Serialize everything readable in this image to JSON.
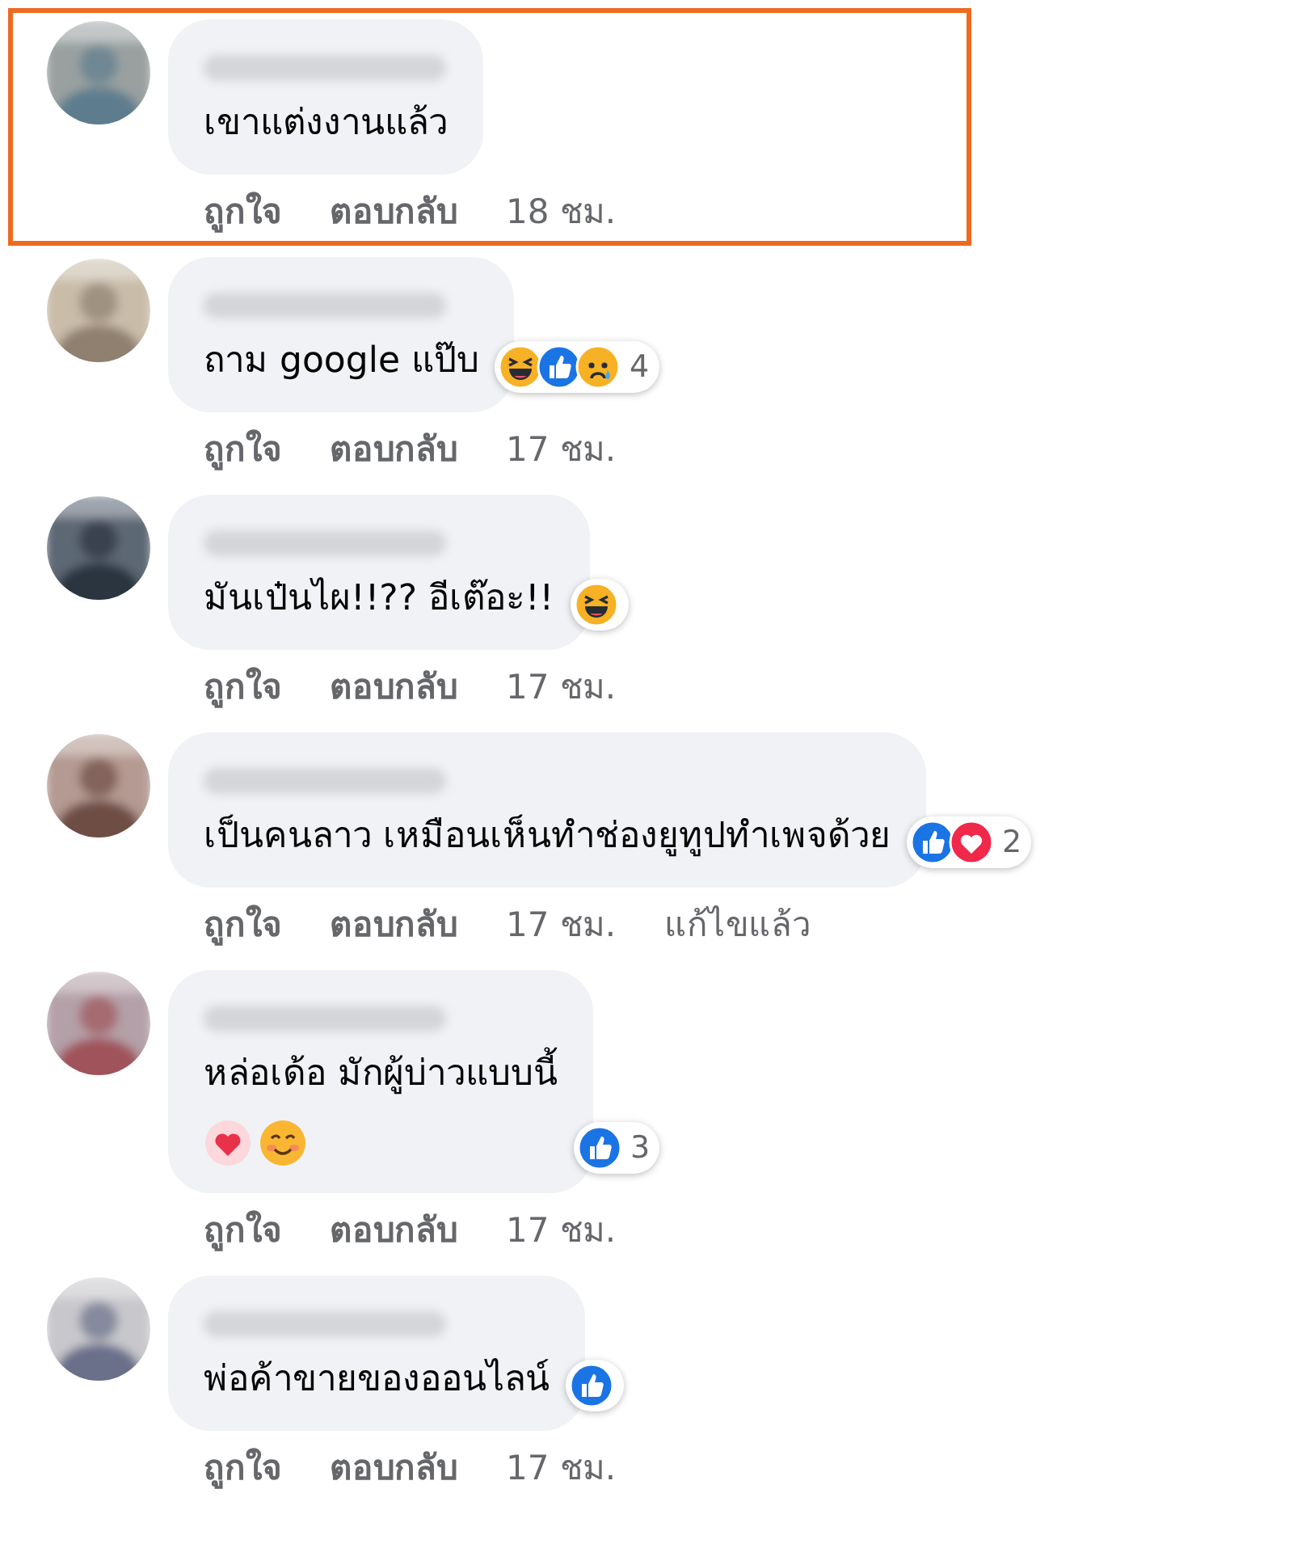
{
  "comments": [
    {
      "highlighted": true,
      "text": "เขาแต่งงานแล้ว",
      "actions": [
        {
          "kind": "link",
          "label": "ถูกใจ"
        },
        {
          "kind": "link",
          "label": "ตอบกลับ"
        },
        {
          "kind": "time",
          "label": "18 ชม."
        }
      ]
    },
    {
      "highlighted": false,
      "text": "ถาม google แป๊บ",
      "reactions": {
        "icons": [
          {
            "kind": "haha"
          },
          {
            "kind": "like"
          },
          {
            "kind": "sad"
          }
        ],
        "count": "4"
      },
      "actions": [
        {
          "kind": "link",
          "label": "ถูกใจ"
        },
        {
          "kind": "link",
          "label": "ตอบกลับ"
        },
        {
          "kind": "time",
          "label": "17 ชม."
        }
      ]
    },
    {
      "highlighted": false,
      "text": "มันเป๋นไผ!!?? อีเต๊อะ!!",
      "reactions": {
        "icons": [
          {
            "kind": "haha"
          }
        ]
      },
      "actions": [
        {
          "kind": "link",
          "label": "ถูกใจ"
        },
        {
          "kind": "link",
          "label": "ตอบกลับ"
        },
        {
          "kind": "time",
          "label": "17 ชม."
        }
      ]
    },
    {
      "highlighted": false,
      "text": "เป็นคนลาว เหมือนเห็นทำช่องยูทูปทำเพจด้วย",
      "reactions": {
        "icons": [
          {
            "kind": "like"
          },
          {
            "kind": "love"
          }
        ],
        "count": "2"
      },
      "actions": [
        {
          "kind": "link",
          "label": "ถูกใจ"
        },
        {
          "kind": "link",
          "label": "ตอบกลับ"
        },
        {
          "kind": "time",
          "label": "17 ชม."
        },
        {
          "kind": "note",
          "label": "แก้ไขแล้ว"
        }
      ]
    },
    {
      "highlighted": false,
      "text": "หล่อเด้อ มักผู้บ่าวแบบนี้",
      "emojis": [
        {
          "kind": "heart"
        },
        {
          "kind": "smile"
        }
      ],
      "reactions": {
        "icons": [
          {
            "kind": "like"
          }
        ],
        "count": "3"
      },
      "actions": [
        {
          "kind": "link",
          "label": "ถูกใจ"
        },
        {
          "kind": "link",
          "label": "ตอบกลับ"
        },
        {
          "kind": "time",
          "label": "17 ชม."
        }
      ]
    },
    {
      "highlighted": false,
      "text": "พ่อค้าขายของออนไลน์",
      "reactions": {
        "icons": [
          {
            "kind": "like"
          }
        ]
      },
      "actions": [
        {
          "kind": "link",
          "label": "ถูกใจ"
        },
        {
          "kind": "link",
          "label": "ตอบกลับ"
        },
        {
          "kind": "time",
          "label": "17 ชม."
        }
      ]
    }
  ]
}
